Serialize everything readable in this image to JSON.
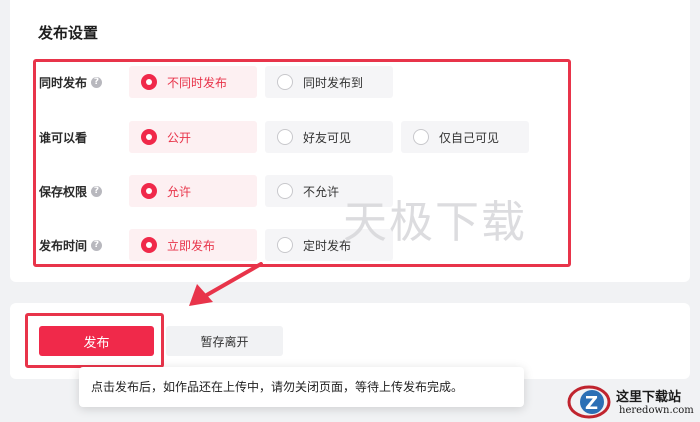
{
  "section_title": "发布设置",
  "settings": {
    "publish_sync": {
      "label": "同时发布",
      "options": [
        "不同时发布",
        "同时发布到"
      ],
      "selected": "不同时发布"
    },
    "visibility": {
      "label": "谁可以看",
      "options": [
        "公开",
        "好友可见",
        "仅自己可见"
      ],
      "selected": "公开"
    },
    "save_permission": {
      "label": "保存权限",
      "options": [
        "允许",
        "不允许"
      ],
      "selected": "允许"
    },
    "publish_time": {
      "label": "发布时间",
      "options": [
        "立即发布",
        "定时发布"
      ],
      "selected": "立即发布"
    }
  },
  "watermark": "天极下载",
  "buttons": {
    "publish": "发布",
    "save_draft": "暂存离开"
  },
  "tooltip": "点击发布后，如作品还在上传中，请勿关闭页面，等待上传发布完成。",
  "logo": {
    "name": "这里下载站",
    "domain": "heredown.com"
  },
  "colors": {
    "accent": "#f0294a",
    "annotation": "#e8344a"
  }
}
